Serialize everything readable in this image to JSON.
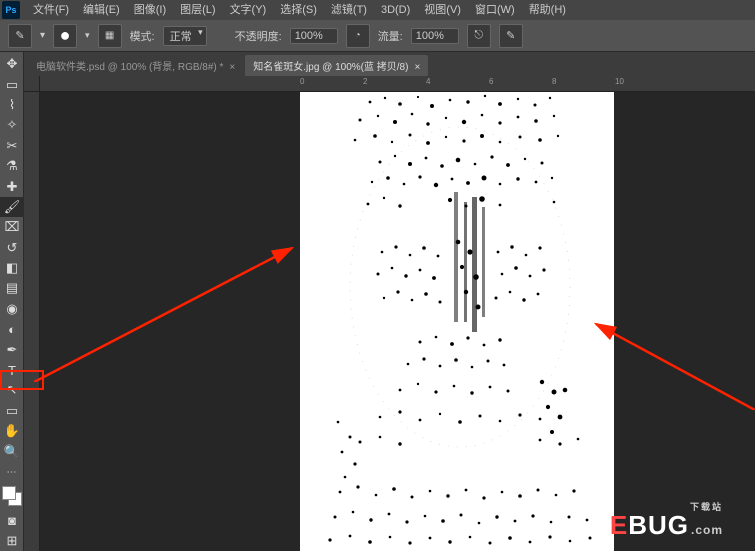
{
  "app": {
    "logo": "Ps"
  },
  "menu": {
    "items": [
      {
        "label": "文件(F)"
      },
      {
        "label": "编辑(E)"
      },
      {
        "label": "图像(I)"
      },
      {
        "label": "图层(L)"
      },
      {
        "label": "文字(Y)"
      },
      {
        "label": "选择(S)"
      },
      {
        "label": "滤镜(T)"
      },
      {
        "label": "3D(D)"
      },
      {
        "label": "视图(V)"
      },
      {
        "label": "窗口(W)"
      },
      {
        "label": "帮助(H)"
      }
    ]
  },
  "options": {
    "mode_label": "模式:",
    "mode_value": "正常",
    "opacity_label": "不透明度:",
    "opacity_value": "100%",
    "flow_label": "流量:",
    "flow_value": "100%"
  },
  "tabs": [
    {
      "label": "电脑软件类.psd @ 100% (背景, RGB/8#) *",
      "active": false
    },
    {
      "label": "知名雀斑女.jpg @ 100%(蓝 拷贝/8)",
      "active": true
    }
  ],
  "ruler": {
    "ticks": [
      "0",
      "2",
      "4",
      "6",
      "8",
      "10"
    ]
  },
  "watermark": {
    "u": "U",
    "e": "E",
    "bug": "BUG",
    "dom": ".com",
    "sub": "下载站"
  }
}
